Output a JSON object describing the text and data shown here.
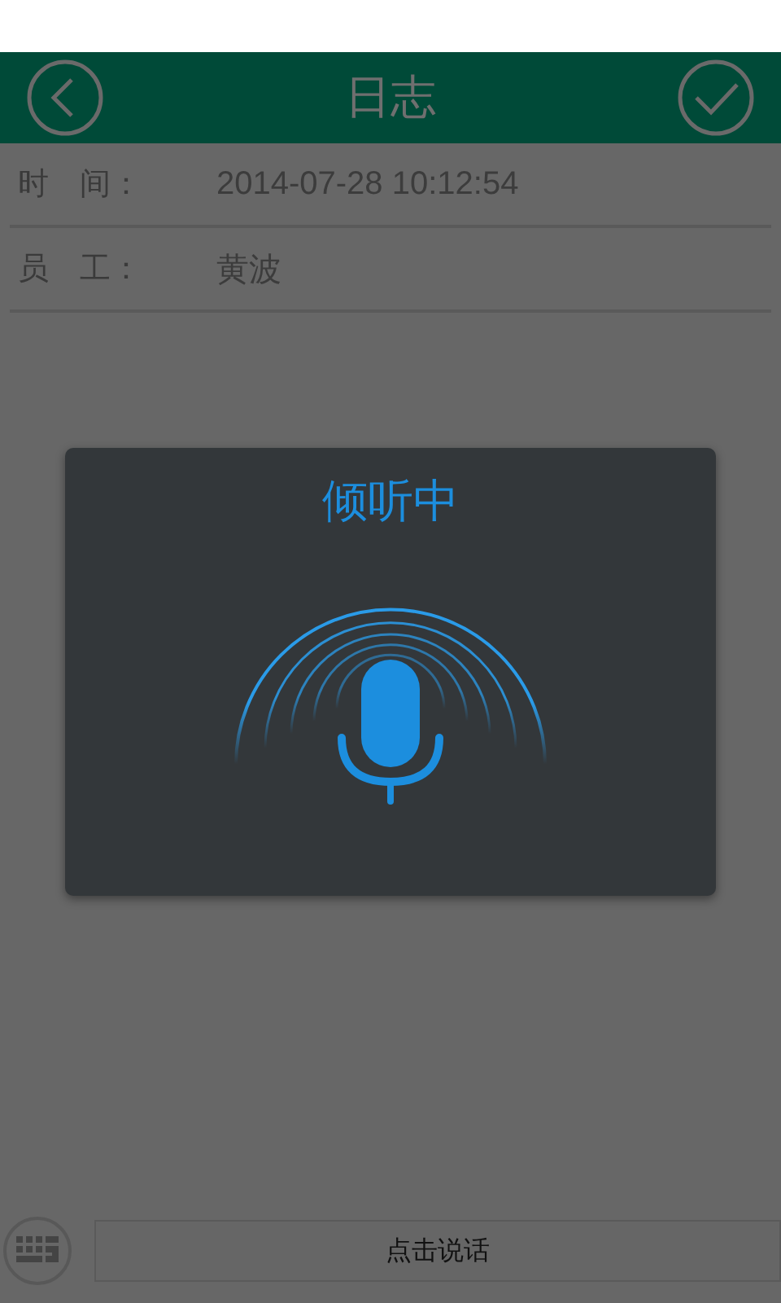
{
  "header": {
    "title": "日志"
  },
  "fields": [
    {
      "label": "时　间：",
      "value": "2014-07-28 10:12:54"
    },
    {
      "label": "员　工：",
      "value": "黄波"
    }
  ],
  "dialog": {
    "title": "倾听中"
  },
  "bottom_bar": {
    "talk_button": "点击说话"
  }
}
